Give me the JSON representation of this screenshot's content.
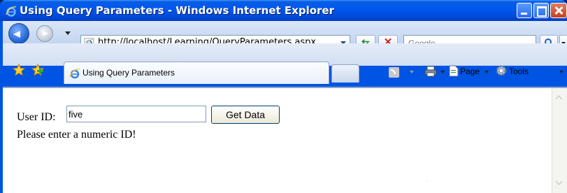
{
  "window": {
    "title": "Using Query Parameters - Windows Internet Explorer"
  },
  "nav": {
    "address": "http://localhost/Learning/QueryParameters.aspx",
    "search_placeholder": "Google"
  },
  "tabs": [
    {
      "label": "Using Query Parameters",
      "active": true
    }
  ],
  "command_bar": {
    "page_label": "Page",
    "tools_label": "Tools"
  },
  "form": {
    "user_id_label": "User ID:",
    "user_id_value": "five",
    "button_label": "Get Data",
    "message": "Please enter a numeric ID!"
  },
  "colors": {
    "titlebar": "#0054e3",
    "content_background": "#ffffff"
  },
  "icons": {
    "title": "ie-icon",
    "address": "ie-page-icon",
    "search": "search-icon",
    "favorites": "favorites-star-icon",
    "add_favorites": "add-favorites-icon",
    "feeds": "feeds-icon",
    "print": "print-icon",
    "page": "page-icon",
    "tools": "gear-icon"
  }
}
